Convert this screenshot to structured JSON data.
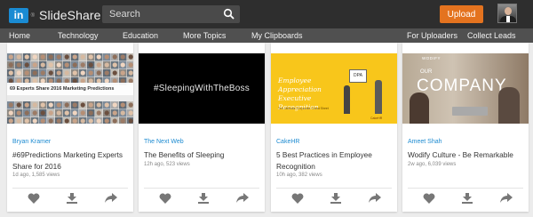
{
  "header": {
    "logo_mark": "in",
    "app_name": "SlideShare",
    "search_placeholder": "Search",
    "upload_label": "Upload"
  },
  "nav": {
    "items": [
      "Home",
      "Technology",
      "Education",
      "More Topics",
      "My Clipboards"
    ],
    "right_items": [
      "For Uploaders",
      "Collect Leads"
    ]
  },
  "cards": [
    {
      "thumb_text_main": "69 Experts Share 2016 Marketing Predictions",
      "thumb_text_side": "Marketing Predictions",
      "author": "Bryan Kramer",
      "title": "#69Predictions Marketing Experts Share for 2016",
      "meta": "1d ago, 1,585 views"
    },
    {
      "thumb_text_main": "#SleepingWithTheBoss",
      "author": "The Next Web",
      "title": "The Benefits of Sleeping",
      "meta": "12h ago, 523 views"
    },
    {
      "thumb_text_main": "Employee Appreciation Executive Recognition",
      "thumb_text_sub": "The Ultimate Corporate Cheat Sheet",
      "thumb_board": "DPA",
      "thumb_logo": "CakeHR",
      "author": "CakeHR",
      "title": "5 Best Practices in Employee Recognition",
      "meta": "10h ago, 382 views"
    },
    {
      "thumb_text_top": "WODIFY",
      "thumb_text_our": "OUR",
      "thumb_text_main": "COMPANY",
      "author": "Ameet Shah",
      "title": "Wodify Culture - Be Remarkable",
      "meta": "2w ago, 6,039 views"
    }
  ]
}
